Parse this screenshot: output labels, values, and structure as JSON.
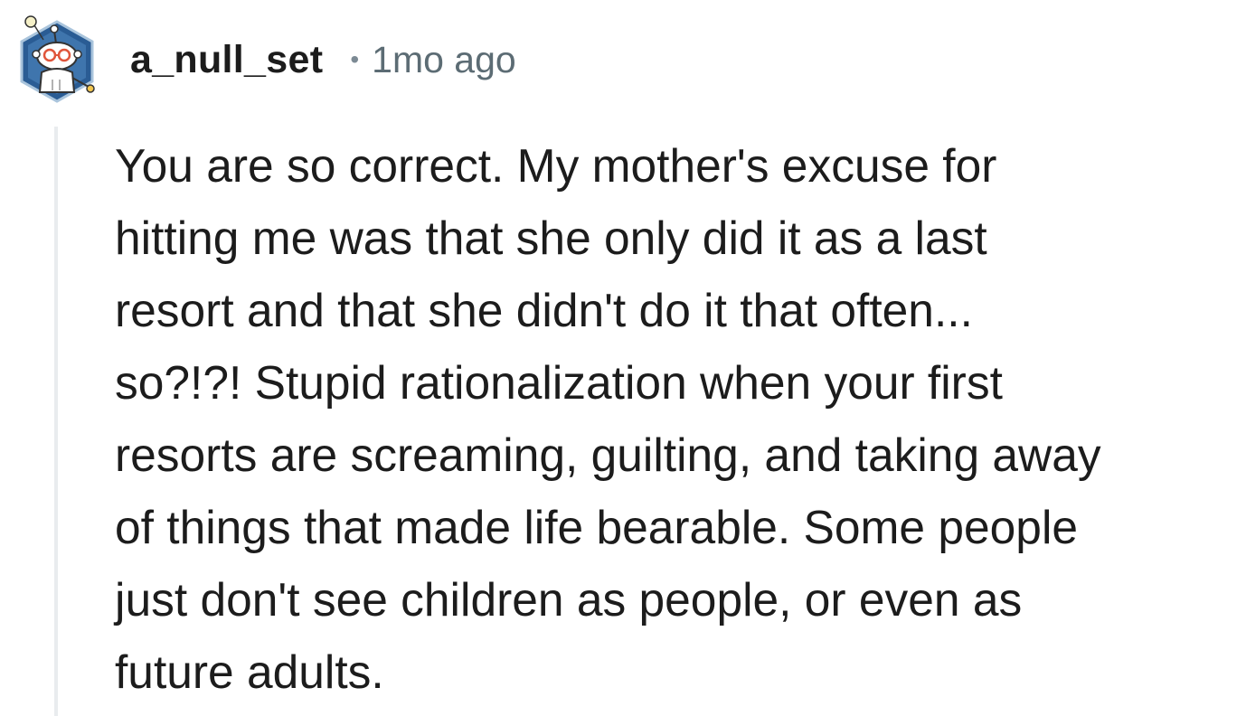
{
  "comment": {
    "author": "a_null_set",
    "separator": "•",
    "timestamp": "1mo ago",
    "avatar_icon": "snoo-avatar-icon",
    "body": "You are so correct. My mother's excuse for\nhitting me was that she only did it as a last\nresort and that she didn't do it that often...\nso?!?! Stupid rationalization when your first\nresorts are screaming, guilting, and taking away\nof things that made life bearable. Some people\njust don't see children as people, or even as\nfuture adults."
  },
  "colors": {
    "text": "#1c1c1c",
    "meta": "#5c6c74",
    "thread_line": "#e9ecee",
    "avatar_bg": "#1a4f8b"
  }
}
